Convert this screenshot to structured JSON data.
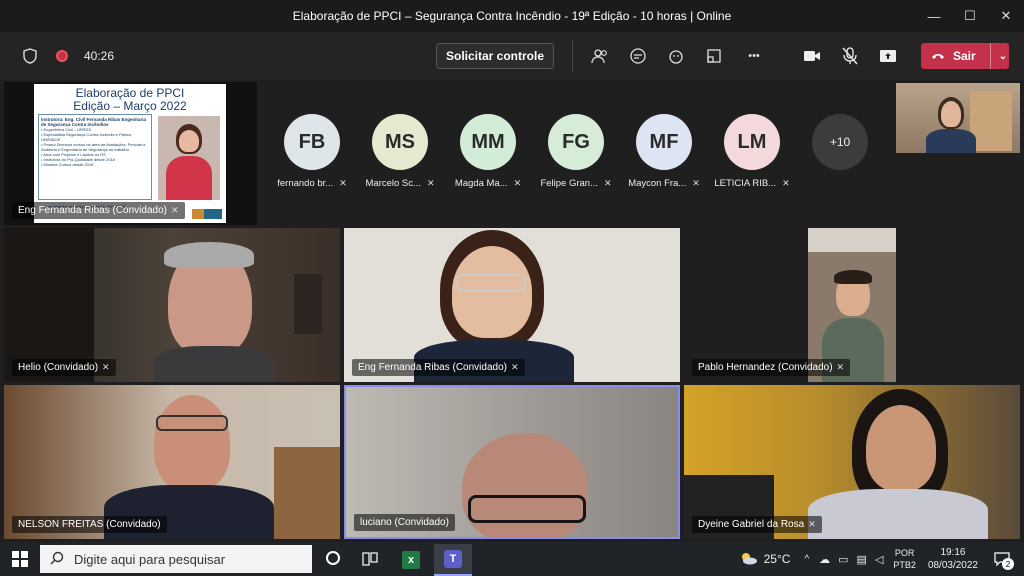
{
  "window": {
    "title": "Elaboração de PPCI – Segurança Contra Incêndio - 19ª Edição - 10 horas | Online",
    "minimize": "—",
    "maximize": "☐",
    "close": "✕"
  },
  "toolbar": {
    "timer": "40:26",
    "request_control": "Solicitar controle",
    "leave": "Sair",
    "more": "•••"
  },
  "slide": {
    "title_line1": "Elaboração de PPCI",
    "title_line2": "Edição – Março 2022",
    "instructor_heading": "Instrutora: Eng. Civil Fernanda Ribas Engenharia de Segurança Contra Incêndios",
    "bullets": [
      "• Engenheira Civil – UFRGS",
      "• Especialista Segurança Contra Incêndio e Pânico UNISINOS",
      "• Possui Diversos cursos na área de Avaliações, Perícias e Auditoria e Engenharia de Segurança do trabalho",
      "• Atua com Projetos e Laudos no RS",
      "• Instrutora do Pró-Qualidade desde 2018",
      "• Ministra Cursos desde 2016"
    ],
    "footer": "contato@prosaudecd.com.br 51 4077-0000",
    "presenter_tag": "Eng Fernanda Ribas (Convidado)"
  },
  "roster": [
    {
      "initials": "FB",
      "name": "fernando br...",
      "color": "#dfe6ea"
    },
    {
      "initials": "MS",
      "name": "Marcelo Sc...",
      "color": "#e4e9cf"
    },
    {
      "initials": "MM",
      "name": "Magda Ma...",
      "color": "#d3ecd8"
    },
    {
      "initials": "FG",
      "name": "Felipe Gran...",
      "color": "#d6ecd9"
    },
    {
      "initials": "MF",
      "name": "Maycon Fra...",
      "color": "#dde5f3"
    },
    {
      "initials": "LM",
      "name": "LETICIA RIB...",
      "color": "#f4d9dc"
    }
  ],
  "overflow_count": "+10",
  "videos": [
    {
      "name": "Helio (Convidado)"
    },
    {
      "name": "Eng Fernanda Ribas (Convidado)"
    },
    {
      "name": "Pablo Hernandez (Convidado)"
    },
    {
      "name": "NELSON FREITAS (Convidado)"
    },
    {
      "name": "luciano (Convidado)"
    },
    {
      "name": "Dyeine Gabriel da Rosa"
    }
  ],
  "taskbar": {
    "search_placeholder": "Digite aqui para pesquisar",
    "weather": "25°C",
    "lang1": "POR",
    "lang2": "PTB2",
    "time": "19:16",
    "date": "08/03/2022",
    "notifications": "2"
  }
}
